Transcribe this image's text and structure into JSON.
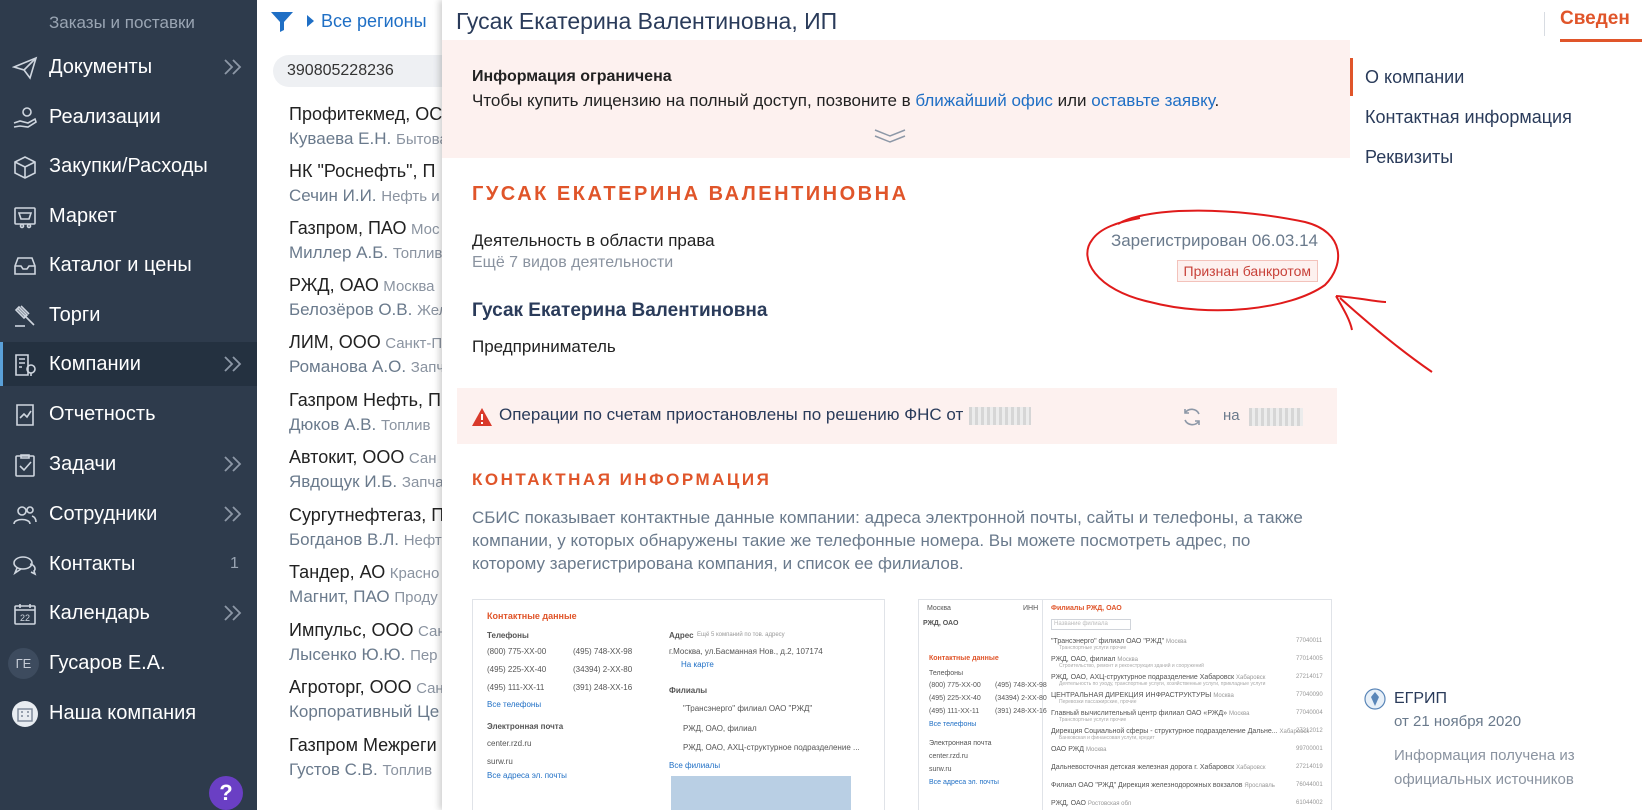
{
  "sidebar": {
    "top_label": "Заказы и поставки",
    "items": [
      {
        "label": "Документы",
        "icon": "paper-plane-icon",
        "chevron": true
      },
      {
        "label": "Реализации",
        "icon": "hand-coins-icon",
        "chevron": false
      },
      {
        "label": "Закупки/Расходы",
        "icon": "box-icon",
        "chevron": false
      },
      {
        "label": "Маркет",
        "icon": "cart-icon",
        "chevron": false
      },
      {
        "label": "Каталог и цены",
        "icon": "catalog-tray-icon",
        "chevron": false
      },
      {
        "label": "Торги",
        "icon": "gavel-icon",
        "chevron": false
      },
      {
        "label": "Компании",
        "icon": "company-building-icon",
        "chevron": true,
        "active": true
      },
      {
        "label": "Отчетность",
        "icon": "report-icon",
        "chevron": false
      },
      {
        "label": "Задачи",
        "icon": "task-clipboard-icon",
        "chevron": true
      },
      {
        "label": "Сотрудники",
        "icon": "people-icon",
        "chevron": true
      },
      {
        "label": "Контакты",
        "icon": "chat-bubbles-icon",
        "chevron": false,
        "count": "1"
      },
      {
        "label": "Календарь",
        "icon": "calendar-icon",
        "chevron": true,
        "icon_text": "22"
      },
      {
        "label": "Гусаров Е.А.",
        "icon": "user-avatar",
        "chevron": false,
        "avatar": "ГЕ"
      },
      {
        "label": "Наша компания",
        "icon": "our-company-icon",
        "chevron": false
      }
    ],
    "help": "?"
  },
  "list": {
    "region": "Все регионы",
    "search_value": "390805228236",
    "companies": [
      {
        "name": "Профитекмед, ОС",
        "region": "",
        "head": "Куваева Е.Н.",
        "activity": "Бытова"
      },
      {
        "name": "НК \"Роснефть\", П",
        "region": "",
        "head": "Сечин И.И.",
        "activity": "Нефть и"
      },
      {
        "name": "Газпром, ПАО",
        "region": "Мос",
        "head": "Миллер А.Б.",
        "activity": "Топлив"
      },
      {
        "name": "РЖД, ОАО",
        "region": "Москва",
        "head": "Белозёров О.В.",
        "activity": "Жел"
      },
      {
        "name": "ЛИМ, ООО",
        "region": "Санкт-П",
        "head": "Романова А.О.",
        "activity": "Запч"
      },
      {
        "name": "Газпром Нефть, П",
        "region": "",
        "head": "Дюков А.В.",
        "activity": "Топлив"
      },
      {
        "name": "Автокит, ООО",
        "region": "Сан",
        "head": "Явдощук И.Б.",
        "activity": "Запча"
      },
      {
        "name": "Сургутнефтегаз, П",
        "region": "",
        "head": "Богданов В.Л.",
        "activity": "Нефт"
      },
      {
        "name": "Тандер, АО",
        "region": "Красно",
        "head": "Магнит, ПАО",
        "activity": "Проду"
      },
      {
        "name": "Импульс, ООО",
        "region": "Сан",
        "head": "Лысенко Ю.Ю.",
        "activity": "Пер"
      },
      {
        "name": "Агроторг, ООО",
        "region": "Сан",
        "head": "Корпоративный Це",
        "activity": ""
      },
      {
        "name": "Газпром Межреги",
        "region": "",
        "head": "Густов С.В.",
        "activity": "Топлив"
      }
    ]
  },
  "panel": {
    "title": "Гусак Екатерина Валентиновна, ИП",
    "tab": "Сведен",
    "restricted": {
      "title": "Информация ограничена",
      "text_before": "Чтобы купить лицензию на полный доступ, позвоните в ",
      "link1": "ближайший офис",
      "text_mid": " или ",
      "link2": "оставьте заявку",
      "text_after": "."
    },
    "company_name": "ГУСАК ЕКАТЕРИНА ВАЛЕНТИНОВНА",
    "activity": "Деятельность в области права",
    "activity_more": "Ещё 7 видов деятельности",
    "registered": "Зарегистрирован 06.03.14",
    "bankrupt_badge": "Признан банкротом",
    "person": "Гусак Екатерина Валентиновна",
    "role": "Предприниматель",
    "alert": {
      "text": "Операции по счетам приостановлены по решению ФНС от",
      "on": "на"
    },
    "contact_heading": "КОНТАКТНАЯ ИНФОРМАЦИЯ",
    "contact_desc": "СБИС показывает контактные данные компании: адреса электронной почты, сайты и телефоны, а также компании, у которых обнаружены такие же телефонные номера. Вы можете посмотреть адрес, по которому зарегистрирована компания, и список ее филиалов.",
    "preview1": {
      "title": "Контактные данные",
      "phones_label": "Телефоны",
      "phones": [
        "(800) 775-XX-00",
        "(495) 748-XX-98",
        "(495) 225-XX-40",
        "(34394) 2-XX-80",
        "(495) 111-XX-11",
        "(391) 248-XX-16"
      ],
      "all_phones": "Все телефоны",
      "email_label": "Электронная почта",
      "emails": [
        "center.rzd.ru",
        "surw.ru"
      ],
      "all_emails": "Все адреса эл. почты",
      "address_label": "Адрес",
      "address_note": "Ещё 5 компаний по тов. адресу",
      "address": "г.Москва, ул.Басманная Нов., д.2, 107174",
      "on_map": "На карте",
      "branches_label": "Филиалы",
      "branches": [
        "\"Трансэнерго\" филиал ОАО \"РЖД\"",
        "РЖД, ОАО, филиал",
        "РЖД, ОАО, АХЦ-структурное подразделение ..."
      ],
      "all_branches": "Все филиалы"
    },
    "preview2": {
      "city": "Москва",
      "company": "РЖД, ОАО",
      "inn": "ИНН",
      "branches_title": "Филиалы РЖД, ОАО",
      "search_placeholder": "Название филиала",
      "contacts_title": "Контактные данные",
      "phones_label": "Телефоны",
      "phones": [
        "(800) 775-XX-00",
        "(495) 748-XX-98",
        "(495) 225-XX-40",
        "(34394) 2-XX-80",
        "(495) 111-XX-11",
        "(391) 248-XX-16"
      ],
      "all_phones": "Все телефоны",
      "email_label": "Электронная почта",
      "emails": [
        "center.rzd.ru",
        "surw.ru"
      ],
      "all_emails": "Все адреса эл. почты",
      "branch_rows": [
        {
          "name": "\"Трансэнерго\" филиал ОАО \"РЖД\"",
          "city": "Москва",
          "sub": "Транспортные услуги прочие",
          "code": "77040011"
        },
        {
          "name": "РЖД, ОАО, филиал",
          "city": "Москва",
          "sub": "Строительство, ремонт и реконструкция зданий и сооружений",
          "code": "77014005"
        },
        {
          "name": "РЖД, ОАО, АХЦ-структурное подразделение Хабаровск",
          "city": "Хабаровск",
          "sub": "Деятельность по уходу, транспортные услуги, хозяйственные услуги, прикладные услуги",
          "code": "27214017"
        },
        {
          "name": "ЦЕНТРАЛЬНАЯ ДИРЕКЦИЯ ИНФРАСТРУКТУРЫ",
          "city": "Москва",
          "sub": "Перевозки пассажирские, прочие",
          "code": "77040090"
        },
        {
          "name": "Главный вычислительный центр филиал ОАО «РЖД»",
          "city": "Москва",
          "sub": "Транспортные услуги прочие",
          "code": "77040004"
        },
        {
          "name": "Дирекция Социальной сферы - структурное подразделение Дальне...",
          "city": "Хабаровск",
          "sub": "Банковская и финансовая услуги, кредит",
          "code": "27212012"
        },
        {
          "name": "ОАО РЖД",
          "city": "Москва",
          "sub": "",
          "code": "99700001"
        },
        {
          "name": "Дальневосточная детская железная дорога г. Хабаровск",
          "city": "Хабаровск",
          "sub": "",
          "code": "27214019"
        },
        {
          "name": "Филиал ОАО \"РЖД\" Дирекция железнодорожных вокзалов",
          "city": "Ярославль",
          "sub": "",
          "code": "76044001"
        },
        {
          "name": "РЖД, ОАО",
          "city": "Ростовская обл",
          "sub": "",
          "code": "61044002"
        }
      ]
    }
  },
  "anchor_nav": [
    {
      "label": "О компании",
      "active": true
    },
    {
      "label": "Контактная информация",
      "active": false
    },
    {
      "label": "Реквизиты",
      "active": false
    }
  ],
  "egrip": {
    "title": "ЕГРИП",
    "date": "от 21 ноября 2020",
    "info": "Информация получена из официальных источников"
  },
  "colors": {
    "sidebar_bg": "#2e3b4c",
    "accent_orange": "#e0552a",
    "link_blue": "#1f6fc5",
    "annotation_red": "#e01b1b"
  }
}
